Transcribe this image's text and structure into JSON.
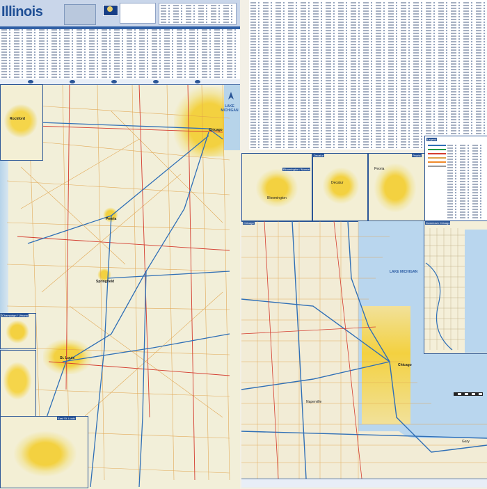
{
  "header": {
    "title": "Illinois"
  },
  "inset_titles": {
    "bloomington_normal": "Bloomington / Normal",
    "decatur": "Decatur",
    "peoria": "Peoria",
    "champaign_urbana": "Champaign / Urbana",
    "east_st_louis": "East St. Louis",
    "chicago": "Chicago",
    "downtown_chicago": "Downtown Chicago"
  },
  "legend": {
    "title": "Legend"
  },
  "labels": {
    "rockford": "Rockford",
    "chicago_state": "Chicago",
    "lake_michigan_state": "LAKE MICHIGAN",
    "peoria_city": "Peoria",
    "springfield": "Springfield",
    "st_louis": "St. Louis",
    "bloomington": "Bloomington",
    "decatur_city": "Decatur",
    "peoria_inset_city": "Peoria",
    "lake_michigan_chicago": "LAKE MICHIGAN",
    "chicago_city": "Chicago",
    "naperville": "Naperville",
    "gary": "Gary",
    "rockford_inset": "Rockford"
  },
  "colors": {
    "brand_blue": "#2a5596",
    "water": "#b9d6ee",
    "urban": "#f3d140",
    "land": "#f2efd9",
    "interstate": "#2f6fb6",
    "us_highway": "#d43c2f",
    "state_road": "#e0a24a"
  }
}
